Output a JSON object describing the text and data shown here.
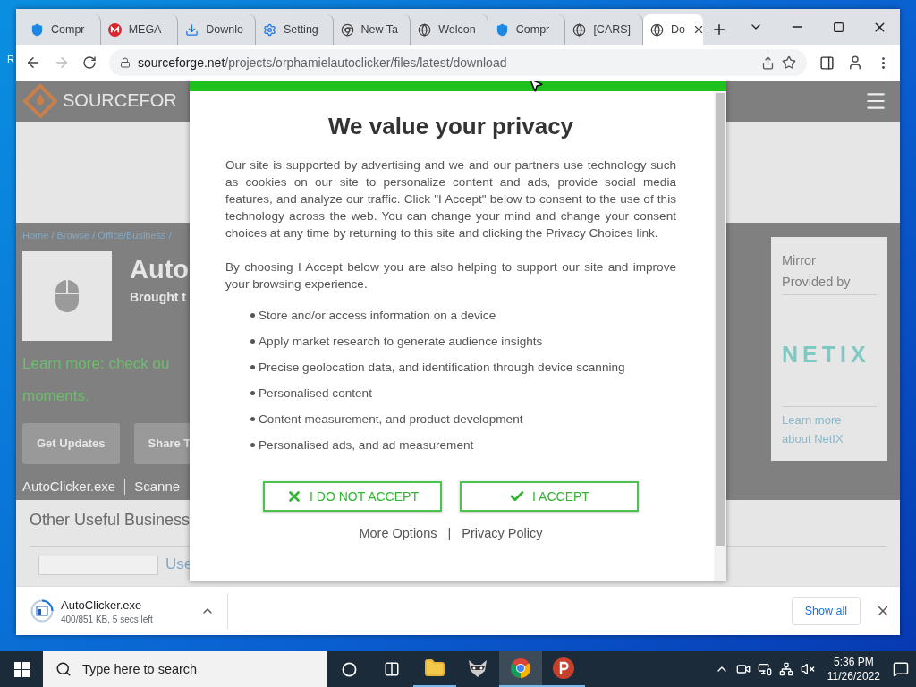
{
  "desktop": {
    "label": "R"
  },
  "browser": {
    "tabs": [
      {
        "kind": "shield",
        "title": "Compr",
        "selected": false
      },
      {
        "kind": "mega",
        "title": "MEGA",
        "selected": false
      },
      {
        "kind": "download",
        "title": "Downlo",
        "selected": false
      },
      {
        "kind": "gear",
        "title": "Setting",
        "selected": false
      },
      {
        "kind": "chrome",
        "title": "New Ta",
        "selected": false
      },
      {
        "kind": "globe",
        "title": "Welcon",
        "selected": false
      },
      {
        "kind": "shield",
        "title": "Compr",
        "selected": false
      },
      {
        "kind": "globe",
        "title": "[CARS]",
        "selected": false
      },
      {
        "kind": "globe",
        "title": "Do",
        "selected": true
      }
    ],
    "url": {
      "host": "sourceforge.net",
      "path": "/projects/orphamielautoclicker/files/latest/download"
    }
  },
  "page": {
    "logo": "SOURCEFOR",
    "breadcrumb": "Home / Browse / Office/Business /",
    "project_title": "Auto",
    "byline": "Brought t",
    "notice": [
      "Learn more: check ou",
      "moments."
    ],
    "buttons": [
      "Get Updates",
      "Share T"
    ],
    "file_name": "AutoClicker.exe",
    "scan": "Scanne",
    "section_title": "Other Useful Business",
    "listing_link": "Use",
    "mirror": {
      "heading": "Mirror Provided by",
      "logo": "NETIX",
      "link": "Learn more about NetIX"
    }
  },
  "privacy_dialog": {
    "title": "We value your privacy",
    "paragraphs": [
      "Our site is supported by advertising and we and our partners use technology such as cookies on our site to personalize content and ads, provide social media features, and analyze our traffic. Click \"I Accept\" below to consent to the use of this technology across the web. You can change your mind and change your consent choices at any time by returning to this site and clicking the Privacy Choices link.",
      "By choosing I Accept below you are also helping to support our site and improve your browsing experience."
    ],
    "purposes": [
      "Store and/or access information on a device",
      "Apply market research to generate audience insights",
      "Precise geolocation data, and identification through device scanning",
      "Personalised content",
      "Content measurement, and product development",
      "Personalised ads, and ad measurement"
    ],
    "buttons": [
      {
        "kind": "reject",
        "label": "I DO NOT ACCEPT"
      },
      {
        "kind": "accept",
        "label": "I ACCEPT"
      }
    ],
    "links": [
      "More Options",
      "Privacy Policy"
    ],
    "separator": "|"
  },
  "download_bar": {
    "file": "AutoClicker.exe",
    "status": "400/851 KB, 5 secs left",
    "show_all": "Show all"
  },
  "taskbar": {
    "search_placeholder": "Type here to search",
    "apps": [
      {
        "kind": "explorer",
        "running": true,
        "selected": false
      },
      {
        "kind": "raccoon",
        "running": false,
        "selected": false
      },
      {
        "kind": "chrome",
        "running": true,
        "selected": true
      },
      {
        "kind": "psiphon",
        "running": true,
        "selected": false
      }
    ],
    "time": "5:36 PM",
    "date": "11/26/2022"
  }
}
